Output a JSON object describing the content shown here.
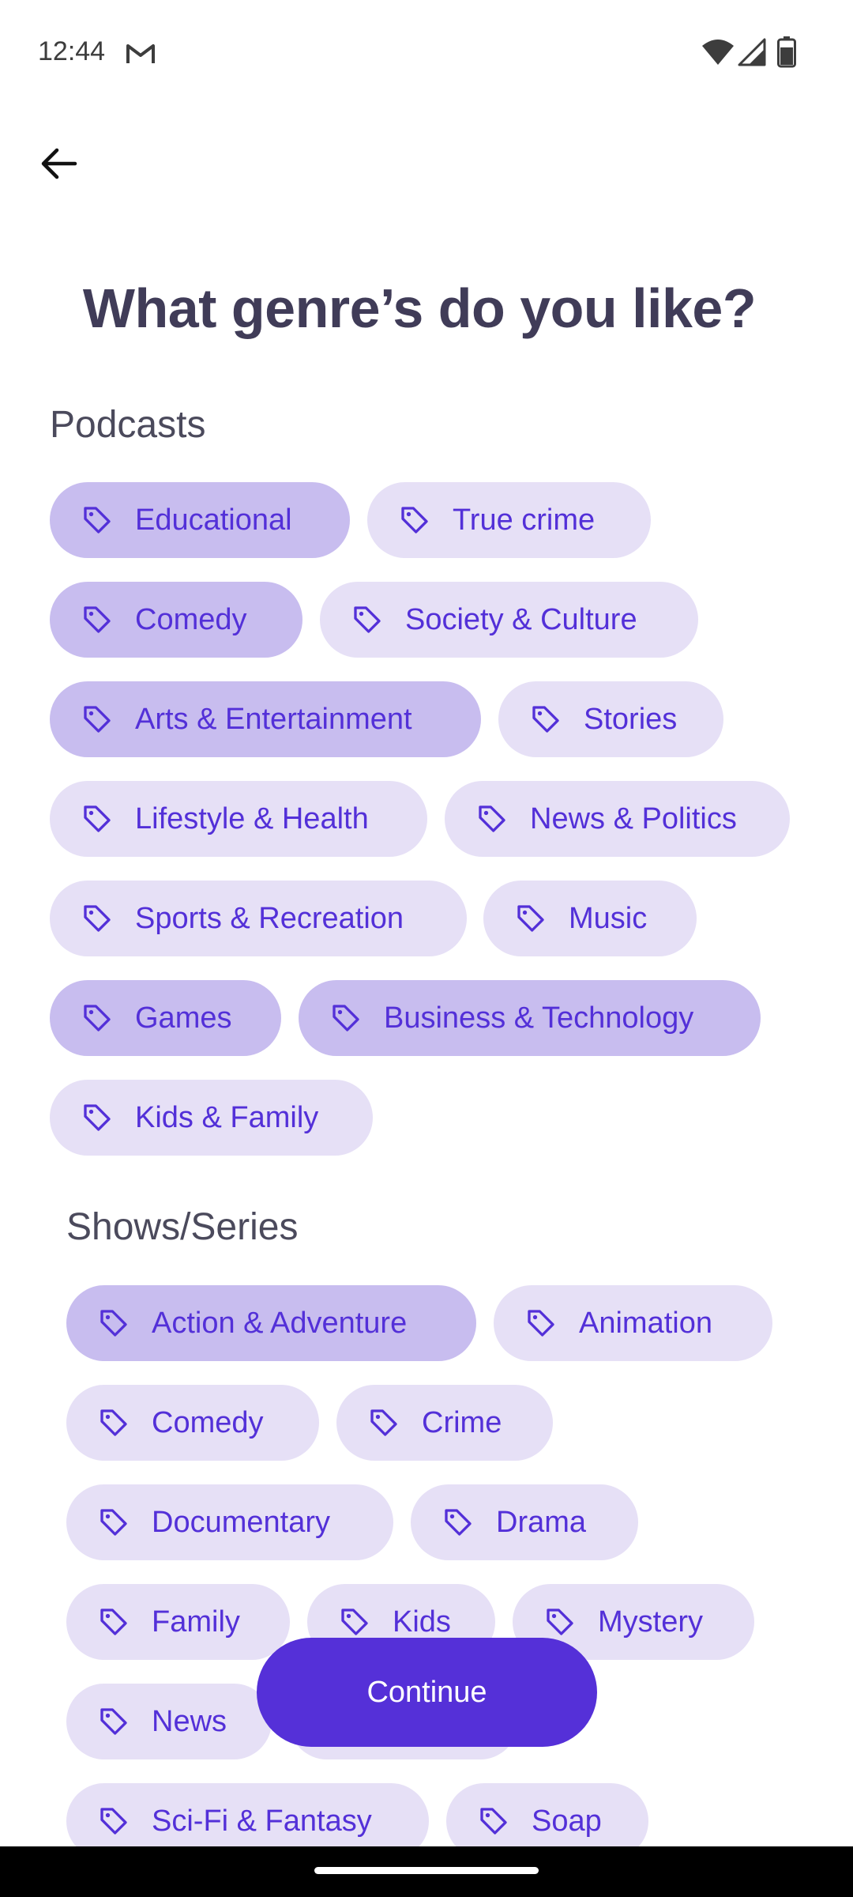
{
  "status_bar": {
    "time": "12:44"
  },
  "page": {
    "title": "What genre’s do you like?"
  },
  "sections": {
    "podcasts": {
      "title": "Podcasts",
      "chips": [
        {
          "label": "Educational",
          "selected": true
        },
        {
          "label": "True crime",
          "selected": false
        },
        {
          "label": "Comedy",
          "selected": true
        },
        {
          "label": "Society & Culture",
          "selected": false
        },
        {
          "label": "Arts & Entertainment",
          "selected": true
        },
        {
          "label": "Stories",
          "selected": false
        },
        {
          "label": "Lifestyle & Health",
          "selected": false
        },
        {
          "label": "News & Politics",
          "selected": false
        },
        {
          "label": "Sports & Recreation",
          "selected": false
        },
        {
          "label": "Music",
          "selected": false
        },
        {
          "label": "Games",
          "selected": true
        },
        {
          "label": "Business & Technology",
          "selected": true
        },
        {
          "label": "Kids & Family",
          "selected": false
        }
      ]
    },
    "shows": {
      "title": "Shows/Series",
      "chips": [
        {
          "label": "Action & Adventure",
          "selected": true
        },
        {
          "label": "Animation",
          "selected": false
        },
        {
          "label": "Comedy",
          "selected": false
        },
        {
          "label": "Crime",
          "selected": false
        },
        {
          "label": "Documentary",
          "selected": false
        },
        {
          "label": "Drama",
          "selected": false
        },
        {
          "label": "Family",
          "selected": false
        },
        {
          "label": "Kids",
          "selected": false
        },
        {
          "label": "Mystery",
          "selected": false
        },
        {
          "label": "News",
          "selected": false
        },
        {
          "label": "Sci-Fi & Fantasy",
          "selected": false
        },
        {
          "label": "Soap",
          "selected": false
        }
      ]
    }
  },
  "actions": {
    "continue_label": "Continue"
  },
  "icons": {
    "back": "arrow-left-icon",
    "chip": "tag-icon",
    "mail": "gmail-icon",
    "wifi": "wifi-icon",
    "signal": "signal-icon",
    "battery": "battery-icon"
  },
  "colors": {
    "accent": "#5530d8",
    "chip_label": "#5330d8",
    "chip_background": "#e6e0f6",
    "chip_selected_background": "#c8bdef",
    "title_text": "#403c58"
  }
}
